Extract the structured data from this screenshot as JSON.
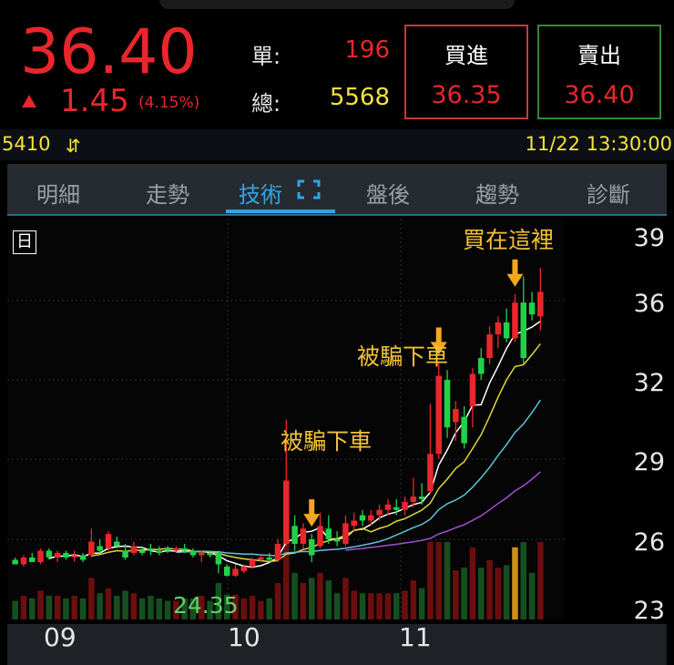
{
  "quote": {
    "price": "36.40",
    "change": "1.45",
    "change_pct": "(4.15%)",
    "single_label": "單:",
    "single_value": "196",
    "total_label": "總:",
    "total_value": "5568",
    "bid_label": "買進",
    "bid_price": "36.35",
    "ask_label": "賣出",
    "ask_price": "36.40",
    "up_color": "#e8262b"
  },
  "info": {
    "stock_code": "5410",
    "datetime": "11/22 13:30:00"
  },
  "tabs": [
    {
      "label": "明細"
    },
    {
      "label": "走勢"
    },
    {
      "label": "技術"
    },
    {
      "label": "盤後"
    },
    {
      "label": "趨勢"
    },
    {
      "label": "診斷"
    }
  ],
  "active_tab": "技術",
  "chart": {
    "period_label": "日",
    "low_price_label": "24.35",
    "annotations": [
      "被騙下車",
      "被騙下車",
      "買在這裡"
    ],
    "y_ticks": [
      "39",
      "36",
      "32",
      "29",
      "26",
      "23"
    ],
    "x_ticks": [
      "09",
      "10",
      "11"
    ]
  },
  "chart_data": {
    "type": "candlestick",
    "y_ticks": [
      39,
      36,
      32,
      29,
      26,
      23
    ],
    "x_ticks": [
      "09",
      "10",
      "11"
    ],
    "candles": [
      {
        "o": 25.1,
        "h": 25.2,
        "l": 24.9,
        "c": 24.9
      },
      {
        "o": 24.9,
        "h": 25.3,
        "l": 24.8,
        "c": 25.2
      },
      {
        "o": 25.2,
        "h": 25.4,
        "l": 25.0,
        "c": 25.0
      },
      {
        "o": 25.0,
        "h": 25.6,
        "l": 24.9,
        "c": 25.5
      },
      {
        "o": 25.5,
        "h": 25.6,
        "l": 25.1,
        "c": 25.2
      },
      {
        "o": 25.2,
        "h": 25.5,
        "l": 25.0,
        "c": 25.4
      },
      {
        "o": 25.4,
        "h": 25.5,
        "l": 25.1,
        "c": 25.2
      },
      {
        "o": 25.2,
        "h": 25.5,
        "l": 25.0,
        "c": 25.3
      },
      {
        "o": 25.3,
        "h": 25.4,
        "l": 25.0,
        "c": 25.1
      },
      {
        "o": 25.3,
        "h": 26.4,
        "l": 25.2,
        "c": 25.9
      },
      {
        "o": 25.7,
        "h": 26.0,
        "l": 25.4,
        "c": 25.5
      },
      {
        "o": 25.6,
        "h": 26.3,
        "l": 25.5,
        "c": 26.2
      },
      {
        "o": 25.9,
        "h": 26.1,
        "l": 25.6,
        "c": 25.7
      },
      {
        "o": 25.5,
        "h": 25.8,
        "l": 25.1,
        "c": 25.2
      },
      {
        "o": 25.4,
        "h": 25.9,
        "l": 25.3,
        "c": 25.7
      },
      {
        "o": 25.5,
        "h": 25.7,
        "l": 25.3,
        "c": 25.4
      },
      {
        "o": 25.6,
        "h": 25.8,
        "l": 25.3,
        "c": 25.5
      },
      {
        "o": 25.5,
        "h": 25.7,
        "l": 25.3,
        "c": 25.4
      },
      {
        "o": 25.6,
        "h": 25.7,
        "l": 25.4,
        "c": 25.5
      },
      {
        "o": 25.5,
        "h": 25.7,
        "l": 25.4,
        "c": 25.6
      },
      {
        "o": 25.6,
        "h": 25.8,
        "l": 25.4,
        "c": 25.5
      },
      {
        "o": 25.5,
        "h": 25.6,
        "l": 25.2,
        "c": 25.3
      },
      {
        "o": 25.3,
        "h": 25.5,
        "l": 25.0,
        "c": 25.4
      },
      {
        "o": 25.4,
        "h": 25.5,
        "l": 25.2,
        "c": 25.3
      },
      {
        "o": 25.4,
        "h": 25.5,
        "l": 24.5,
        "c": 24.9
      },
      {
        "o": 24.8,
        "h": 24.9,
        "l": 24.35,
        "c": 24.4
      },
      {
        "o": 24.4,
        "h": 24.9,
        "l": 24.35,
        "c": 24.7
      },
      {
        "o": 24.6,
        "h": 24.9,
        "l": 24.5,
        "c": 24.8
      },
      {
        "o": 24.8,
        "h": 25.2,
        "l": 24.7,
        "c": 25.1
      },
      {
        "o": 25.1,
        "h": 25.3,
        "l": 25.0,
        "c": 25.2
      },
      {
        "o": 25.2,
        "h": 25.4,
        "l": 25.0,
        "c": 25.1
      },
      {
        "o": 25.1,
        "h": 26.0,
        "l": 25.0,
        "c": 25.8
      },
      {
        "o": 25.8,
        "h": 30.5,
        "l": 25.7,
        "c": 28.2
      },
      {
        "o": 26.5,
        "h": 26.9,
        "l": 25.5,
        "c": 25.8
      },
      {
        "o": 25.8,
        "h": 26.6,
        "l": 25.6,
        "c": 26.4
      },
      {
        "o": 26.0,
        "h": 26.2,
        "l": 25.0,
        "c": 25.3
      },
      {
        "o": 25.7,
        "h": 27.0,
        "l": 25.6,
        "c": 26.5
      },
      {
        "o": 26.4,
        "h": 26.9,
        "l": 25.8,
        "c": 26.0
      },
      {
        "o": 26.0,
        "h": 26.3,
        "l": 25.7,
        "c": 25.9
      },
      {
        "o": 25.8,
        "h": 26.9,
        "l": 25.7,
        "c": 26.6
      },
      {
        "o": 26.5,
        "h": 27.0,
        "l": 26.3,
        "c": 26.7
      },
      {
        "o": 26.9,
        "h": 27.1,
        "l": 26.5,
        "c": 26.7
      },
      {
        "o": 26.7,
        "h": 27.1,
        "l": 26.5,
        "c": 26.9
      },
      {
        "o": 26.9,
        "h": 27.3,
        "l": 26.7,
        "c": 27.1
      },
      {
        "o": 27.1,
        "h": 27.5,
        "l": 26.9,
        "c": 27.3
      },
      {
        "o": 27.2,
        "h": 27.5,
        "l": 26.9,
        "c": 27.1
      },
      {
        "o": 27.1,
        "h": 27.6,
        "l": 26.9,
        "c": 27.4
      },
      {
        "o": 27.4,
        "h": 28.3,
        "l": 27.2,
        "c": 27.6
      },
      {
        "o": 27.6,
        "h": 28.1,
        "l": 27.3,
        "c": 27.5
      },
      {
        "o": 27.8,
        "h": 31.1,
        "l": 27.7,
        "c": 29.2
      },
      {
        "o": 29.2,
        "h": 32.9,
        "l": 29.0,
        "c": 32.2
      },
      {
        "o": 32.0,
        "h": 32.5,
        "l": 29.8,
        "c": 30.2
      },
      {
        "o": 30.4,
        "h": 31.2,
        "l": 29.7,
        "c": 30.9
      },
      {
        "o": 30.6,
        "h": 31.0,
        "l": 29.4,
        "c": 29.6
      },
      {
        "o": 31.0,
        "h": 32.6,
        "l": 30.2,
        "c": 32.3
      },
      {
        "o": 33.1,
        "h": 33.6,
        "l": 32.0,
        "c": 32.3
      },
      {
        "o": 33.1,
        "h": 34.7,
        "l": 32.8,
        "c": 34.3
      },
      {
        "o": 34.3,
        "h": 35.2,
        "l": 33.6,
        "c": 34.9
      },
      {
        "o": 34.9,
        "h": 35.6,
        "l": 33.9,
        "c": 34.1
      },
      {
        "o": 34.1,
        "h": 36.3,
        "l": 33.9,
        "c": 35.9
      },
      {
        "o": 35.9,
        "h": 37.1,
        "l": 32.8,
        "c": 33.1
      },
      {
        "o": 35.9,
        "h": 36.4,
        "l": 35.0,
        "c": 35.3
      },
      {
        "o": 35.2,
        "h": 37.5,
        "l": 34.5,
        "c": 36.4
      }
    ],
    "annotations": [
      {
        "text": "被騙下車",
        "candle_index": 35
      },
      {
        "text": "被騙下車",
        "candle_index": 50
      },
      {
        "text": "買在這裡",
        "candle_index": 59
      }
    ],
    "low_label": {
      "text": "24.35",
      "value": 24.35
    },
    "colors": {
      "up": "#e8262b",
      "down": "#21d14a",
      "ma5": "#ffffff",
      "ma10": "#e3d63b",
      "ma20": "#5ec4d9",
      "ma60": "#a24fd6",
      "volume_hi": "#f2a81d"
    }
  }
}
